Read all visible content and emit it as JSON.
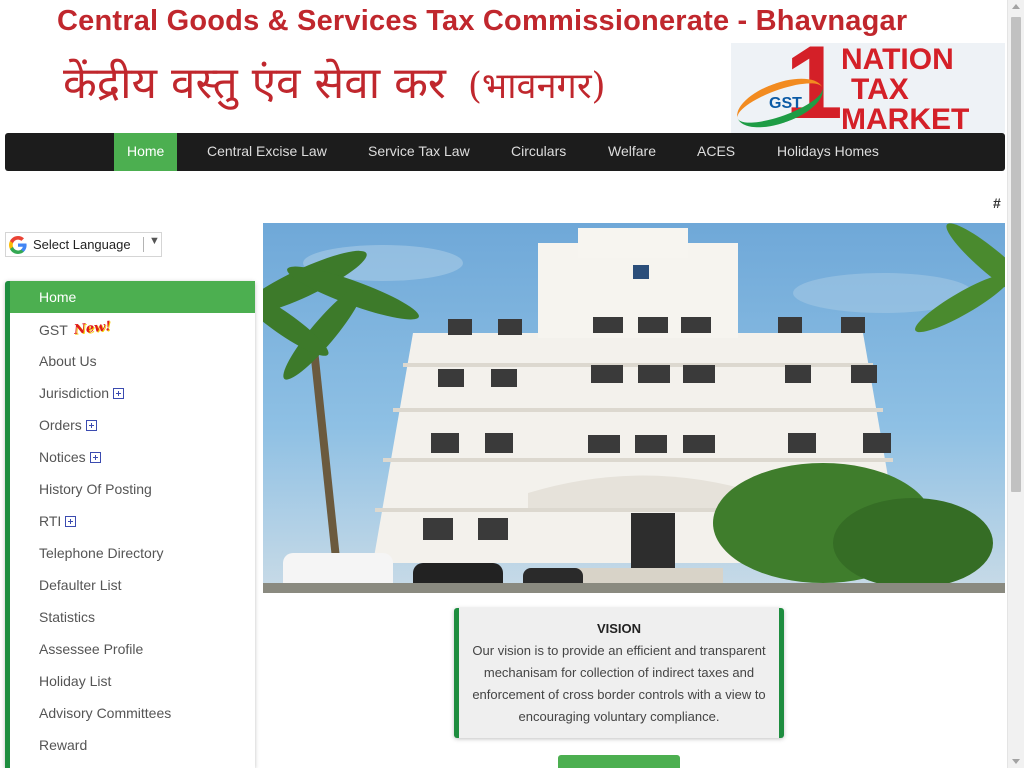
{
  "banner": {
    "title_en": "Central Goods & Services Tax Commissionerate - Bhavnagar",
    "title_hi": "केंद्रीय वस्तु एंव सेवा कर",
    "title_hi_city": "(भावनगर)",
    "logo": {
      "number": "1",
      "gst": "GST",
      "line1": "NATION",
      "line2": "TAX",
      "line3": "MARKET"
    }
  },
  "nav": {
    "items": [
      {
        "label": "Home",
        "active": true
      },
      {
        "label": "Central Excise Law"
      },
      {
        "label": "Service Tax Law"
      },
      {
        "label": "Circulars"
      },
      {
        "label": "Welfare"
      },
      {
        "label": "ACES"
      },
      {
        "label": "Holidays Homes"
      }
    ]
  },
  "hash_link": "#",
  "translate": {
    "label": "Select Language",
    "caret": "▼",
    "icon": "google-g-icon"
  },
  "sidebar": {
    "items": [
      {
        "label": "Home",
        "active": true
      },
      {
        "label": "GST",
        "badge": "New!"
      },
      {
        "label": "About Us"
      },
      {
        "label": "Jurisdiction",
        "expandable": true
      },
      {
        "label": "Orders",
        "expandable": true
      },
      {
        "label": "Notices",
        "expandable": true
      },
      {
        "label": "History Of Posting"
      },
      {
        "label": "RTI",
        "expandable": true
      },
      {
        "label": "Telephone Directory"
      },
      {
        "label": "Defaulter List"
      },
      {
        "label": "Statistics"
      },
      {
        "label": "Assessee Profile"
      },
      {
        "label": "Holiday List"
      },
      {
        "label": "Advisory Committees"
      },
      {
        "label": "Reward"
      }
    ]
  },
  "vision": {
    "title": "VISION",
    "text": "Our vision is to provide an efficient and transparent mechanisam for collection of indirect taxes and enforcement of cross border controls with a view to encouraging voluntary compliance."
  },
  "colors": {
    "accent_green": "#4caf50",
    "border_green": "#1e8d3f",
    "banner_red": "#c0272d",
    "nav_bg": "#1c1c1c"
  }
}
